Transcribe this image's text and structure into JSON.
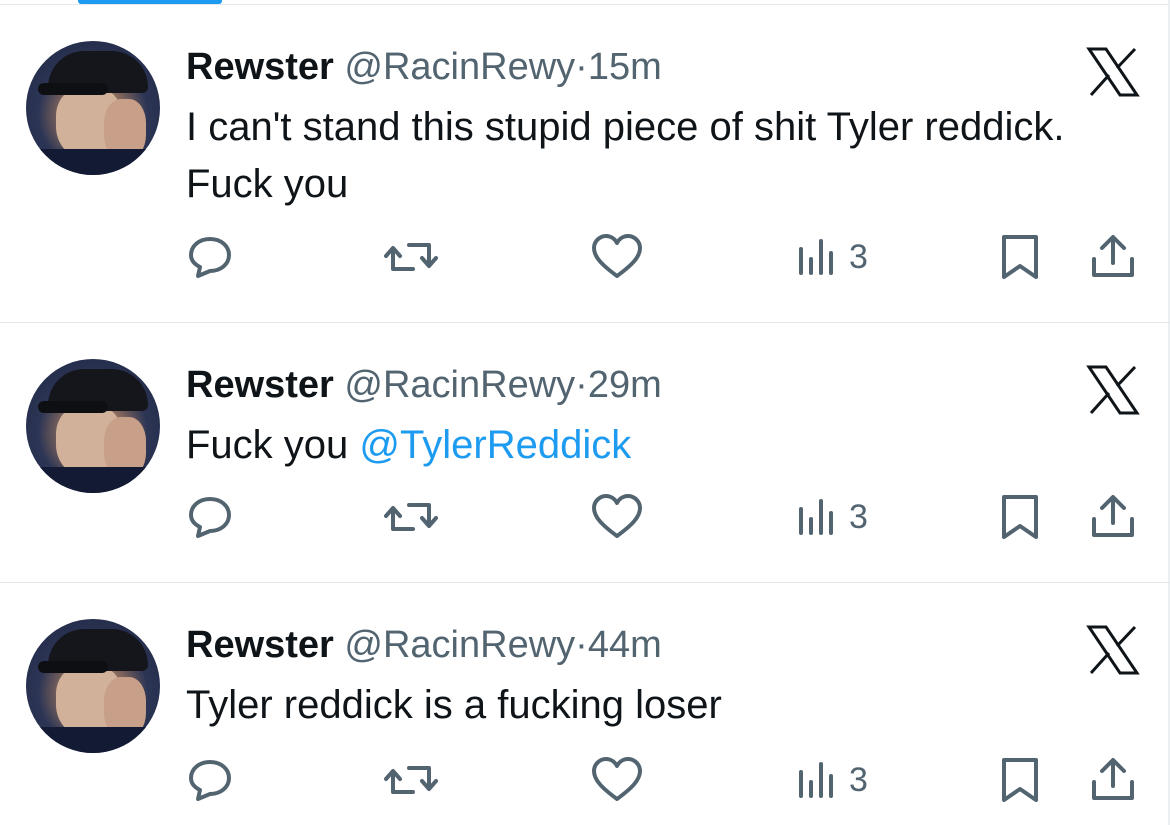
{
  "tweets": [
    {
      "name": "Rewster",
      "handle": "@RacinRewy",
      "separator": "·",
      "time": "15m",
      "text_parts": [
        {
          "text": "I can't stand this stupid piece of shit Tyler reddick. Fuck you",
          "mention": false
        }
      ],
      "views_count": "3"
    },
    {
      "name": "Rewster",
      "handle": "@RacinRewy",
      "separator": "·",
      "time": "29m",
      "text_parts": [
        {
          "text": "Fuck you ",
          "mention": false
        },
        {
          "text": "@TylerReddick",
          "mention": true
        }
      ],
      "views_count": "3"
    },
    {
      "name": "Rewster",
      "handle": "@RacinRewy",
      "separator": "·",
      "time": "44m",
      "text_parts": [
        {
          "text": "Tyler reddick is a fucking loser",
          "mention": false
        }
      ],
      "views_count": "3"
    }
  ],
  "icons": {
    "brand": "x-logo-icon",
    "reply": "reply-icon",
    "retweet": "retweet-icon",
    "like": "heart-icon",
    "views": "views-icon",
    "bookmark": "bookmark-icon",
    "share": "share-icon"
  },
  "colors": {
    "text": "#0f1419",
    "secondary": "#536471",
    "accent": "#1d9bf0",
    "divider": "#e2e6e9"
  }
}
